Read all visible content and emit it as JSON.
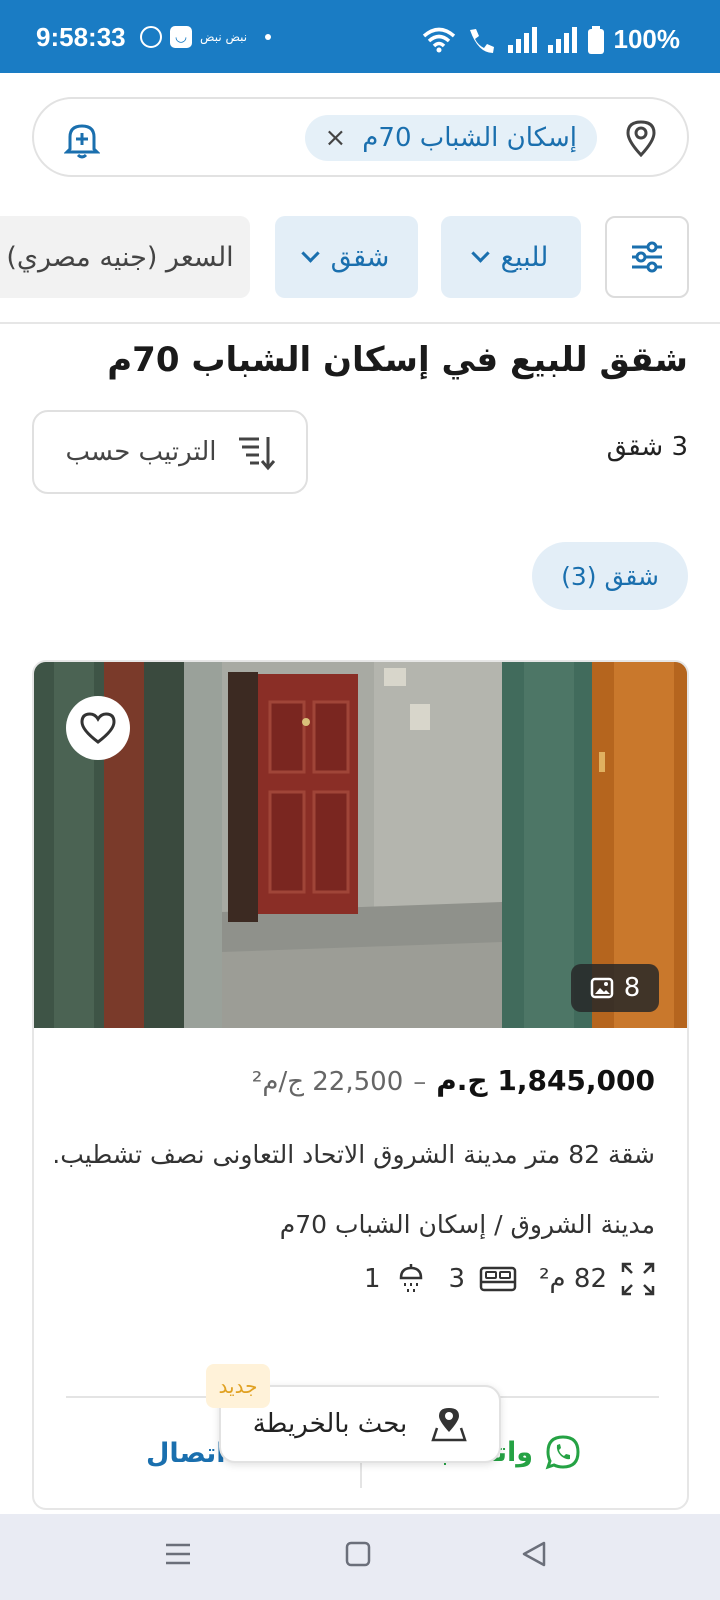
{
  "status_bar": {
    "time": "9:58:33",
    "notification_text": "نبض نبض",
    "battery": "100%"
  },
  "search": {
    "chip_label": "إسكان الشباب 70م",
    "chip_close": "×"
  },
  "filters": {
    "sale": "للبيع",
    "type": "شقق",
    "price": "السعر (جنيه مصري)"
  },
  "results": {
    "title": "شقق للبيع في إسكان الشباب 70م",
    "count": "3 شقق",
    "sort_label": "الترتيب حسب",
    "type_chip": "شقق (3)"
  },
  "listing": {
    "photo_count": "8",
    "price": "1,845,000 ج.م",
    "separator": "–",
    "price_per_meter": "22,500 ج/م²",
    "description": "شقة 82 متر مدينة الشروق الاتحاد التعاونى نصف تشطيب...",
    "location": "مدينة الشروق / إسكان الشباب 70م",
    "area": "82 م²",
    "bedrooms": "3",
    "bathrooms": "1",
    "call_label": "اتصال",
    "whatsapp_label": "واتساب"
  },
  "map_button": {
    "label": "بحث بالخريطة",
    "badge": "جديد"
  },
  "colors": {
    "brand": "#1a7cc4",
    "chip_bg": "#e3eef7",
    "whatsapp": "#25a244",
    "badge": "#e0a122"
  }
}
